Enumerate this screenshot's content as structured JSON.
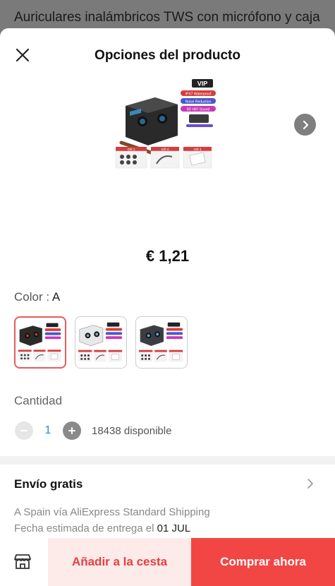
{
  "background_title": "Auriculares inalámbricos TWS con micrófono y caja",
  "sheet": {
    "title": "Opciones del producto",
    "close_icon": "close-icon",
    "next_icon": "chevron-right-icon"
  },
  "product": {
    "price": "€ 1,21",
    "image_badges": {
      "vip": "VIP",
      "bullets": [
        "IPX7 Waterproof",
        "Noise Reduction",
        "9D HiFi Sound"
      ],
      "gifts": [
        "Gift 1",
        "Gift 2",
        "Gift 3"
      ]
    }
  },
  "color": {
    "label": "Color : ",
    "value": "A",
    "options": [
      {
        "id": "A",
        "selected": true,
        "case_color": "#2b2b2b",
        "accent": "#c0392b"
      },
      {
        "id": "B",
        "selected": false,
        "case_color": "#e8e8e8",
        "accent": "#8aa7c4"
      },
      {
        "id": "C",
        "selected": false,
        "case_color": "#3a3d42",
        "accent": "#5fa8d6"
      }
    ]
  },
  "quantity": {
    "label": "Cantidad",
    "value": "1",
    "stock": "18438 disponible"
  },
  "shipping": {
    "title": "Envío gratis",
    "line1": "A Spain vía AliExpress Standard Shipping",
    "line2_prefix": "Fecha estimada de entrega el ",
    "date": "01 JUL"
  },
  "actions": {
    "store_icon": "store-icon",
    "add_to_cart": "Añadir a la cesta",
    "buy_now": "Comprar ahora"
  },
  "colors": {
    "accent_red": "#f24645",
    "soft_red": "#fdebea",
    "qty_blue": "#2a8db0"
  }
}
